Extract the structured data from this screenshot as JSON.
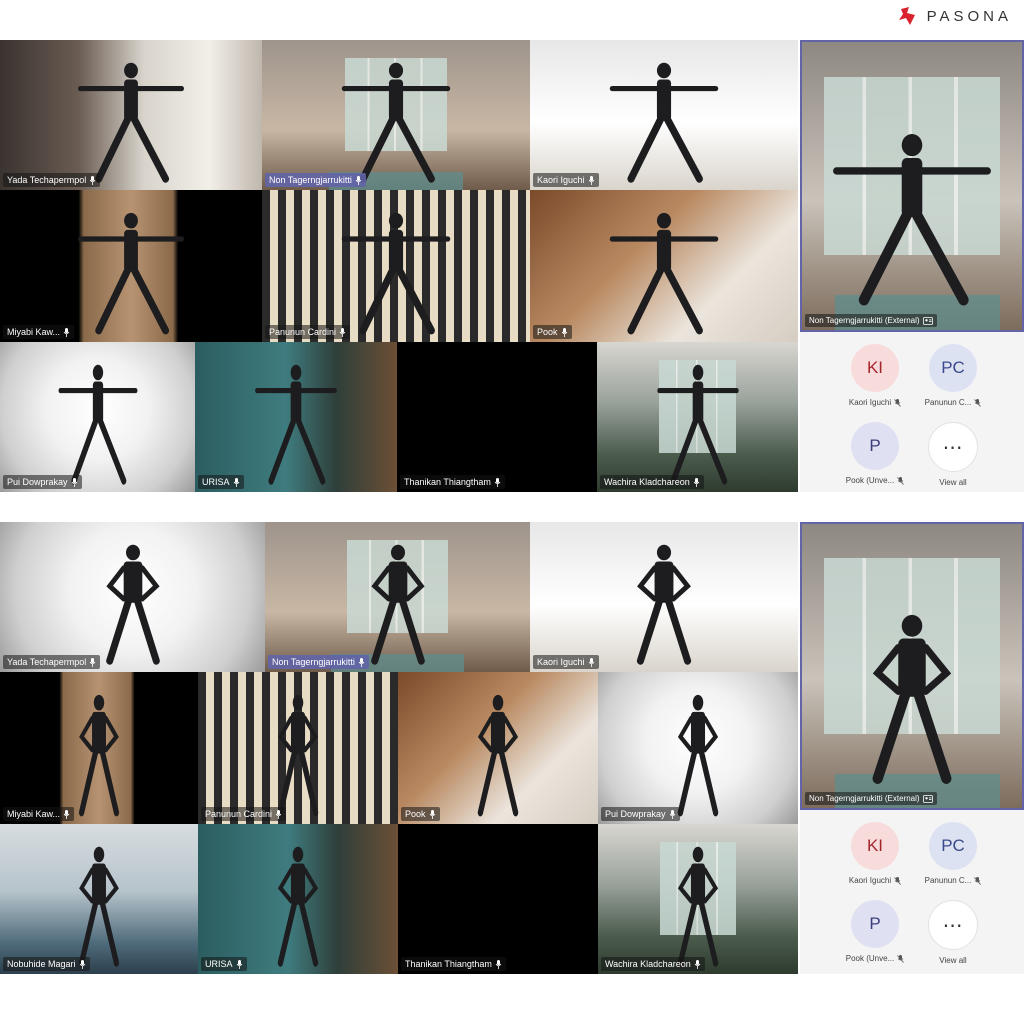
{
  "brand": {
    "name": "PASONA",
    "color": "#d9232e"
  },
  "panels": [
    {
      "tiles": [
        {
          "name": "Yada Techapermpol",
          "bg": "room-window-bright",
          "pose": "warrior"
        },
        {
          "name": "Non Tagerngjarrukitti",
          "bg": "living-room",
          "pose": "warrior",
          "highlight": true
        },
        {
          "name": "Kaori Iguchi",
          "bg": "white-room",
          "pose": "warrior"
        },
        {
          "name": "Miyabi Kaw...",
          "bg": "shelf",
          "pose": "warrior"
        },
        {
          "name": "Panunun Cardini",
          "bg": "striped-wall",
          "pose": "warrior"
        },
        {
          "name": "Pook",
          "bg": "wood-room",
          "pose": "warrior"
        },
        {
          "name": "Pui Dowprakay",
          "bg": "overexposed",
          "pose": "warrior"
        },
        {
          "name": "URISA",
          "bg": "teal-wall",
          "pose": "warrior"
        },
        {
          "name": "Thanikan Thiangtham",
          "bg": "black",
          "pose": "none"
        },
        {
          "name": "Wachira Kladchareon",
          "bg": "window-room",
          "pose": "warrior"
        }
      ],
      "featured": {
        "name": "Non Tagerngjarrukitti (External)",
        "pose": "warrior"
      }
    },
    {
      "tiles": [
        {
          "name": "Yada Techapermpol",
          "bg": "overexposed",
          "pose": "hands-hips"
        },
        {
          "name": "Non Tagerngjarrukitti",
          "bg": "living-room",
          "pose": "hands-hips",
          "highlight": true
        },
        {
          "name": "Kaori Iguchi",
          "bg": "white-room",
          "pose": "hands-hips"
        },
        {
          "name": "Miyabi Kaw...",
          "bg": "shelf",
          "pose": "hands-hips"
        },
        {
          "name": "Panunun Cardini",
          "bg": "striped-wall",
          "pose": "hands-hips"
        },
        {
          "name": "Pook",
          "bg": "wood-room",
          "pose": "hands-hips"
        },
        {
          "name": "Pui Dowprakay",
          "bg": "overexposed",
          "pose": "hands-hips"
        },
        {
          "name": "Nobuhide Magari",
          "bg": "blue-room",
          "pose": "hands-hips"
        },
        {
          "name": "URISA",
          "bg": "teal-wall",
          "pose": "hands-hips"
        },
        {
          "name": "Thanikan Thiangtham",
          "bg": "black",
          "pose": "none"
        },
        {
          "name": "Wachira Kladchareon",
          "bg": "window-room",
          "pose": "hands-hips"
        }
      ],
      "featured": {
        "name": "Non Tagerngjarrukitti (External)",
        "pose": "hands-hips"
      }
    }
  ],
  "roster": [
    {
      "initials": "KI",
      "label": "Kaori Iguchi",
      "style": "ki"
    },
    {
      "initials": "PC",
      "label": "Panunun C...",
      "style": "pc"
    },
    {
      "initials": "P",
      "label": "Pook (Unve...",
      "style": "p"
    },
    {
      "initials": "⋯",
      "label": "View all",
      "style": "more"
    }
  ],
  "colors": {
    "accent": "#6264a7",
    "name_tag_bg": "#141414",
    "ki_avatar": "#f8dcdc",
    "pc_avatar": "#dde2f3"
  },
  "icons": {
    "mic": "microphone-icon",
    "external": "external-user-icon",
    "mute": "muted-microphone-icon",
    "logo": "pasona-logo-icon"
  }
}
